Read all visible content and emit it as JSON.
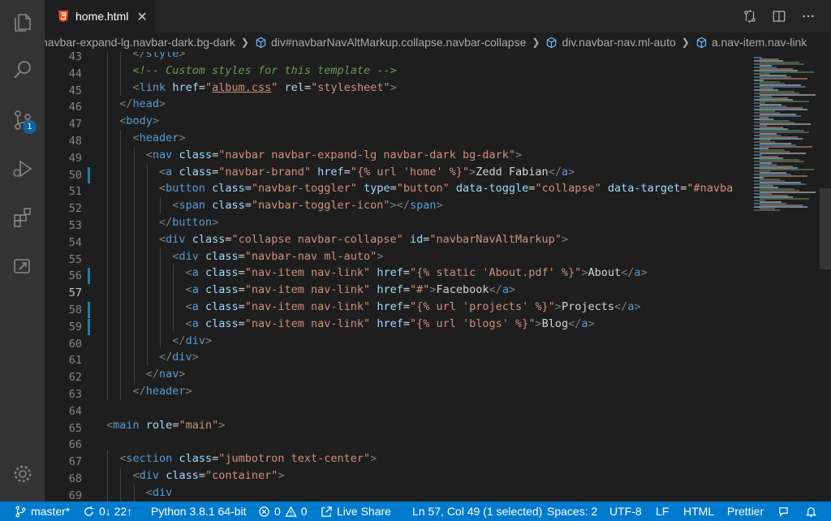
{
  "tab": {
    "title": "home.html",
    "close": "✕",
    "icon": "html5-icon"
  },
  "breadcrumb": [
    {
      "label": "navbar-expand-lg.navbar-dark.bg-dark",
      "icon": ""
    },
    {
      "label": "div#navbarNavAltMarkup.collapse.navbar-collapse",
      "icon": "cube-icon"
    },
    {
      "label": "div.navbar-nav.ml-auto",
      "icon": "cube-icon"
    },
    {
      "label": "a.nav-item.nav-link",
      "icon": "cube-icon"
    }
  ],
  "activity_bar": {
    "items": [
      "explorer-icon",
      "search-icon",
      "source-control-icon",
      "run-debug-icon",
      "extensions-icon",
      "remote-explorer-icon"
    ],
    "scm_badge": "1",
    "settings": "gear-icon"
  },
  "editor": {
    "line_numbers": [
      "43",
      "44",
      "45",
      "46",
      "47",
      "48",
      "49",
      "50",
      "51",
      "52",
      "53",
      "54",
      "55",
      "56",
      "57",
      "58",
      "59",
      "60",
      "61",
      "62",
      "63",
      "64",
      "65",
      "66",
      "67",
      "68",
      "69"
    ],
    "active_line": "57",
    "lines": [
      [
        [
          "p",
          "</"
        ],
        [
          "t",
          "style"
        ],
        [
          "p",
          ">"
        ]
      ],
      [
        [
          "c",
          "<!-- Custom styles for this template -->"
        ]
      ],
      [
        [
          "p",
          "<"
        ],
        [
          "t",
          "link"
        ],
        [
          "x",
          " "
        ],
        [
          "a",
          "href"
        ],
        [
          "x",
          "="
        ],
        [
          "s",
          "\""
        ],
        [
          "su",
          "album.css"
        ],
        [
          "s",
          "\""
        ],
        [
          "x",
          " "
        ],
        [
          "a",
          "rel"
        ],
        [
          "x",
          "="
        ],
        [
          "s",
          "\"stylesheet\""
        ],
        [
          "p",
          ">"
        ]
      ],
      [
        [
          "p",
          "</"
        ],
        [
          "t",
          "head"
        ],
        [
          "p",
          ">"
        ]
      ],
      [
        [
          "p",
          "<"
        ],
        [
          "t",
          "body"
        ],
        [
          "p",
          ">"
        ]
      ],
      [
        [
          "p",
          "<"
        ],
        [
          "t",
          "header"
        ],
        [
          "p",
          ">"
        ]
      ],
      [
        [
          "p",
          "<"
        ],
        [
          "t",
          "nav"
        ],
        [
          "x",
          " "
        ],
        [
          "a",
          "class"
        ],
        [
          "x",
          "="
        ],
        [
          "s",
          "\"navbar navbar-expand-lg navbar-dark bg-dark\""
        ],
        [
          "p",
          ">"
        ]
      ],
      [
        [
          "p",
          "<"
        ],
        [
          "t",
          "a"
        ],
        [
          "x",
          " "
        ],
        [
          "a",
          "class"
        ],
        [
          "x",
          "="
        ],
        [
          "s",
          "\"navbar-brand\""
        ],
        [
          "x",
          " "
        ],
        [
          "a",
          "href"
        ],
        [
          "x",
          "="
        ],
        [
          "s",
          "\"{% url 'home' %}\""
        ],
        [
          "p",
          ">"
        ],
        [
          "x",
          "Zedd Fabian"
        ],
        [
          "p",
          "</"
        ],
        [
          "t",
          "a"
        ],
        [
          "p",
          ">"
        ]
      ],
      [
        [
          "p",
          "<"
        ],
        [
          "t",
          "button"
        ],
        [
          "x",
          " "
        ],
        [
          "a",
          "class"
        ],
        [
          "x",
          "="
        ],
        [
          "s",
          "\"navbar-toggler\""
        ],
        [
          "x",
          " "
        ],
        [
          "a",
          "type"
        ],
        [
          "x",
          "="
        ],
        [
          "s",
          "\"button\""
        ],
        [
          "x",
          " "
        ],
        [
          "a",
          "data-toggle"
        ],
        [
          "x",
          "="
        ],
        [
          "s",
          "\"collapse\""
        ],
        [
          "x",
          " "
        ],
        [
          "a",
          "data-target"
        ],
        [
          "x",
          "="
        ],
        [
          "s",
          "\"#navba"
        ]
      ],
      [
        [
          "p",
          "<"
        ],
        [
          "t",
          "span"
        ],
        [
          "x",
          " "
        ],
        [
          "a",
          "class"
        ],
        [
          "x",
          "="
        ],
        [
          "s",
          "\"navbar-toggler-icon\""
        ],
        [
          "p",
          "></"
        ],
        [
          "t",
          "span"
        ],
        [
          "p",
          ">"
        ]
      ],
      [
        [
          "p",
          "</"
        ],
        [
          "t",
          "button"
        ],
        [
          "p",
          ">"
        ]
      ],
      [
        [
          "p",
          "<"
        ],
        [
          "t",
          "div"
        ],
        [
          "x",
          " "
        ],
        [
          "a",
          "class"
        ],
        [
          "x",
          "="
        ],
        [
          "s",
          "\"collapse navbar-collapse\""
        ],
        [
          "x",
          " "
        ],
        [
          "a",
          "id"
        ],
        [
          "x",
          "="
        ],
        [
          "s",
          "\"navbarNavAltMarkup\""
        ],
        [
          "p",
          ">"
        ]
      ],
      [
        [
          "p",
          "<"
        ],
        [
          "t",
          "div"
        ],
        [
          "x",
          " "
        ],
        [
          "a",
          "class"
        ],
        [
          "x",
          "="
        ],
        [
          "s",
          "\"navbar-nav ml-auto\""
        ],
        [
          "p",
          ">"
        ]
      ],
      [
        [
          "p",
          "<"
        ],
        [
          "t",
          "a"
        ],
        [
          "x",
          " "
        ],
        [
          "a",
          "class"
        ],
        [
          "x",
          "="
        ],
        [
          "s",
          "\"nav-item nav-link\""
        ],
        [
          "x",
          " "
        ],
        [
          "a",
          "href"
        ],
        [
          "x",
          "="
        ],
        [
          "s",
          "\"{% static 'About.pdf' %}\""
        ],
        [
          "p",
          ">"
        ],
        [
          "x",
          "About"
        ],
        [
          "p",
          "</"
        ],
        [
          "t",
          "a"
        ],
        [
          "p",
          ">"
        ]
      ],
      [
        [
          "p",
          "<"
        ],
        [
          "t",
          "a"
        ],
        [
          "x",
          " "
        ],
        [
          "a",
          "class"
        ],
        [
          "x",
          "="
        ],
        [
          "s",
          "\"nav-item nav-link\""
        ],
        [
          "x",
          " "
        ],
        [
          "a",
          "href"
        ],
        [
          "x",
          "="
        ],
        [
          "s",
          "\"#\""
        ],
        [
          "p",
          ">"
        ],
        [
          "x",
          "Facebook"
        ],
        [
          "p",
          "</"
        ],
        [
          "t",
          "a"
        ],
        [
          "p",
          ">"
        ]
      ],
      [
        [
          "p",
          "<"
        ],
        [
          "t",
          "a"
        ],
        [
          "x",
          " "
        ],
        [
          "a",
          "class"
        ],
        [
          "x",
          "="
        ],
        [
          "s",
          "\"nav-item nav-link\""
        ],
        [
          "x",
          " "
        ],
        [
          "a",
          "href"
        ],
        [
          "x",
          "="
        ],
        [
          "s",
          "\"{% url 'projects' %}\""
        ],
        [
          "p",
          ">"
        ],
        [
          "x",
          "Projects"
        ],
        [
          "p",
          "</"
        ],
        [
          "t",
          "a"
        ],
        [
          "p",
          ">"
        ]
      ],
      [
        [
          "p",
          "<"
        ],
        [
          "t",
          "a"
        ],
        [
          "x",
          " "
        ],
        [
          "a",
          "class"
        ],
        [
          "x",
          "="
        ],
        [
          "s",
          "\"nav-item nav-link\""
        ],
        [
          "x",
          " "
        ],
        [
          "a",
          "href"
        ],
        [
          "x",
          "="
        ],
        [
          "s",
          "\"{% url 'blogs' %}\""
        ],
        [
          "p",
          ">"
        ],
        [
          "x",
          "Blog"
        ],
        [
          "p",
          "</"
        ],
        [
          "t",
          "a"
        ],
        [
          "p",
          ">"
        ]
      ],
      [
        [
          "p",
          "</"
        ],
        [
          "t",
          "div"
        ],
        [
          "p",
          ">"
        ]
      ],
      [
        [
          "p",
          "</"
        ],
        [
          "t",
          "div"
        ],
        [
          "p",
          ">"
        ]
      ],
      [
        [
          "p",
          "</"
        ],
        [
          "t",
          "nav"
        ],
        [
          "p",
          ">"
        ]
      ],
      [
        [
          "p",
          "</"
        ],
        [
          "t",
          "header"
        ],
        [
          "p",
          ">"
        ]
      ],
      [],
      [
        [
          "p",
          "<"
        ],
        [
          "t",
          "main"
        ],
        [
          "x",
          " "
        ],
        [
          "a",
          "role"
        ],
        [
          "x",
          "="
        ],
        [
          "s",
          "\"main\""
        ],
        [
          "p",
          ">"
        ]
      ],
      [],
      [
        [
          "p",
          "<"
        ],
        [
          "t",
          "section"
        ],
        [
          "x",
          " "
        ],
        [
          "a",
          "class"
        ],
        [
          "x",
          "="
        ],
        [
          "s",
          "\"jumbotron text-center\""
        ],
        [
          "p",
          ">"
        ]
      ],
      [
        [
          "p",
          "<"
        ],
        [
          "t",
          "div"
        ],
        [
          "x",
          " "
        ],
        [
          "a",
          "class"
        ],
        [
          "x",
          "="
        ],
        [
          "s",
          "\"container\""
        ],
        [
          "p",
          ">"
        ]
      ],
      [
        [
          "p",
          "<"
        ],
        [
          "t",
          "div"
        ]
      ]
    ]
  },
  "status_bar": {
    "branch": "master*",
    "sync": "0↓ 22↑",
    "python": "Python 3.8.1 64-bit",
    "errors": "0",
    "warnings": "0",
    "live_share": "Live Share",
    "cursor": "Ln 57, Col 49 (1 selected)",
    "spaces": "Spaces: 2",
    "encoding": "UTF-8",
    "eol": "LF",
    "language": "HTML",
    "formatter": "Prettier"
  },
  "colors": {
    "statusbar": "#007acc",
    "activitybar": "#333333",
    "editor": "#1e1e1e"
  }
}
